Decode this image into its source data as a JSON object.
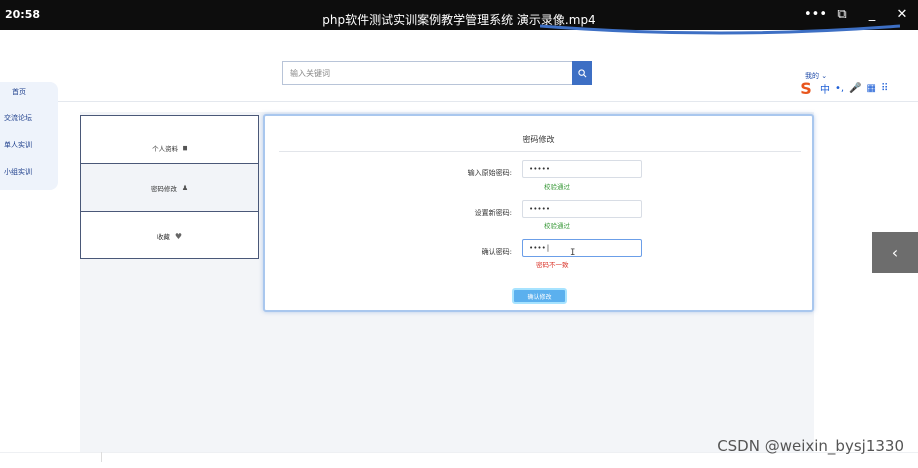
{
  "window": {
    "time": "20:58",
    "title": "php软件测试实训案例教学管理系统 演示录像.mp4",
    "controls": [
      "•••",
      "⧉",
      "_",
      "✕"
    ]
  },
  "search": {
    "placeholder": "输入关键词"
  },
  "user": {
    "label": "我的",
    "chevron": "⌄"
  },
  "ime": {
    "logo": "S",
    "mode": "中",
    "punct": "•,",
    "mic": "🎤",
    "kb": "▦",
    "grid": "⠿"
  },
  "leftnav": {
    "items": [
      {
        "label": "首页"
      },
      {
        "label": "交流论坛"
      },
      {
        "label": "单人实训"
      },
      {
        "label": "小组实训"
      }
    ]
  },
  "sidemenu": {
    "items": [
      {
        "label": "个人资料",
        "icon": "id-card-icon",
        "glyph": "▆"
      },
      {
        "label": "密码修改",
        "icon": "user-icon",
        "glyph": "♟"
      },
      {
        "label": "收藏",
        "icon": "heart-icon",
        "glyph": "♥"
      }
    ]
  },
  "form": {
    "title": "密码修改",
    "fields": [
      {
        "label": "输入原始密码:",
        "value": "•••••",
        "status": "校验通过",
        "status_type": "ok"
      },
      {
        "label": "设置新密码:",
        "value": "•••••",
        "status": "校验通过",
        "status_type": "ok"
      },
      {
        "label": "确认密码:",
        "value": "••••|",
        "status": "密码不一致",
        "status_type": "err"
      }
    ],
    "submit_label": "确认修改"
  },
  "rightarrow": "‹",
  "watermark": "CSDN @weixin_bysj1330",
  "colors": {
    "accent": "#3d6fc4",
    "ok": "#3a9a3a",
    "error": "#d93025",
    "titlebar": "#0d0d0d"
  }
}
